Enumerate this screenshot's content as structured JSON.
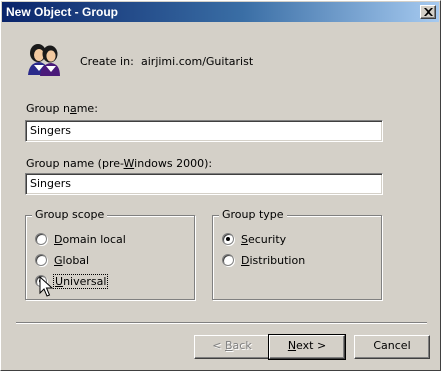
{
  "window": {
    "title": "New Object - Group"
  },
  "icons": {
    "group_icon": "users-icon",
    "close_icon": "close-icon"
  },
  "create_in": {
    "label": "Create in:",
    "value": "airjimi.com/Guitarist"
  },
  "group_name": {
    "label": "Group name:",
    "value": "Singers"
  },
  "group_name_pre2000": {
    "label": "Group name (pre-Windows 2000):",
    "value": "Singers"
  },
  "group_scope": {
    "title": "Group scope",
    "options": [
      {
        "label": "Domain local",
        "selected": false
      },
      {
        "label": "Global",
        "selected": false
      },
      {
        "label": "Universal",
        "selected": true
      }
    ]
  },
  "group_type": {
    "title": "Group type",
    "options": [
      {
        "label": "Security",
        "selected": true
      },
      {
        "label": "Distribution",
        "selected": false
      }
    ]
  },
  "buttons": {
    "back": "< Back",
    "next": "Next >",
    "cancel": "Cancel"
  }
}
